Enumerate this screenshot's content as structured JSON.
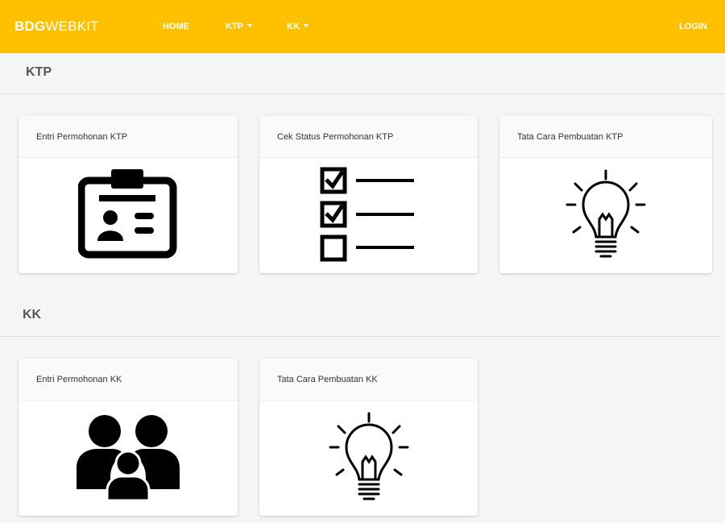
{
  "navbar": {
    "brand_bold": "BDG",
    "brand_rest": "WEBKIT",
    "home_label": "HOME",
    "ktp_label": "KTP",
    "kk_label": "KK",
    "login_label": "LOGIN",
    "background_color": "#ffc000"
  },
  "sections": {
    "ktp": {
      "title": "KTP",
      "cards": [
        {
          "title": "Entri Permohonan KTP",
          "icon": "id-card-icon"
        },
        {
          "title": "Cek Status Permohonan KTP",
          "icon": "checklist-icon"
        },
        {
          "title": "Tata Cara Pembuatan KTP",
          "icon": "lightbulb-icon"
        }
      ]
    },
    "kk": {
      "title": "KK",
      "cards": [
        {
          "title": "Entri Permohonan KK",
          "icon": "family-icon"
        },
        {
          "title": "Tata Cara Pembuatan KK",
          "icon": "lightbulb-icon"
        }
      ]
    }
  }
}
